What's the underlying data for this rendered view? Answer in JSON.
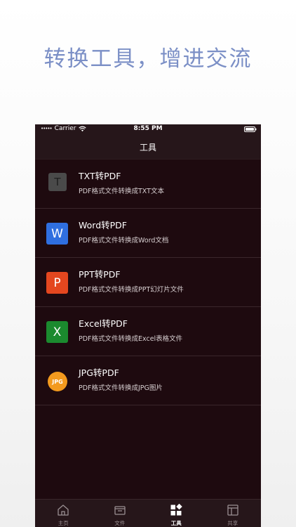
{
  "headline": "转换工具，增进交流",
  "status_bar": {
    "carrier": "Carrier",
    "time": "8:55 PM"
  },
  "nav": {
    "title": "工具"
  },
  "tools": [
    {
      "title": "TXT转PDF",
      "subtitle": "PDF格式文件转换成TXT文本",
      "icon_text": "T",
      "icon": "txt-icon",
      "color": "#4a4a4a"
    },
    {
      "title": "Word转PDF",
      "subtitle": "PDF格式文件转换成Word文档",
      "icon_text": "W",
      "icon": "word-icon",
      "color": "#2f6fe0"
    },
    {
      "title": "PPT转PDF",
      "subtitle": "PDF格式文件转换成PPT幻灯片文件",
      "icon_text": "P",
      "icon": "ppt-icon",
      "color": "#e4471f"
    },
    {
      "title": "Excel转PDF",
      "subtitle": "PDF格式文件转换成Excel表格文件",
      "icon_text": "X",
      "icon": "excel-icon",
      "color": "#1b8a2e"
    },
    {
      "title": "JPG转PDF",
      "subtitle": "PDF格式文件转换成JPG图片",
      "icon_text": "JPG",
      "icon": "jpg-icon",
      "color": "#f39a1e"
    }
  ],
  "tabs": [
    {
      "label": "主页",
      "icon": "home-icon",
      "active": false
    },
    {
      "label": "文件",
      "icon": "folder-icon",
      "active": false
    },
    {
      "label": "工具",
      "icon": "tools-icon",
      "active": true
    },
    {
      "label": "共享",
      "icon": "share-layout-icon",
      "active": false
    }
  ],
  "colors": {
    "headline": "#7b8fc6",
    "background": "#1e0a0f",
    "bar": "#26161a"
  }
}
